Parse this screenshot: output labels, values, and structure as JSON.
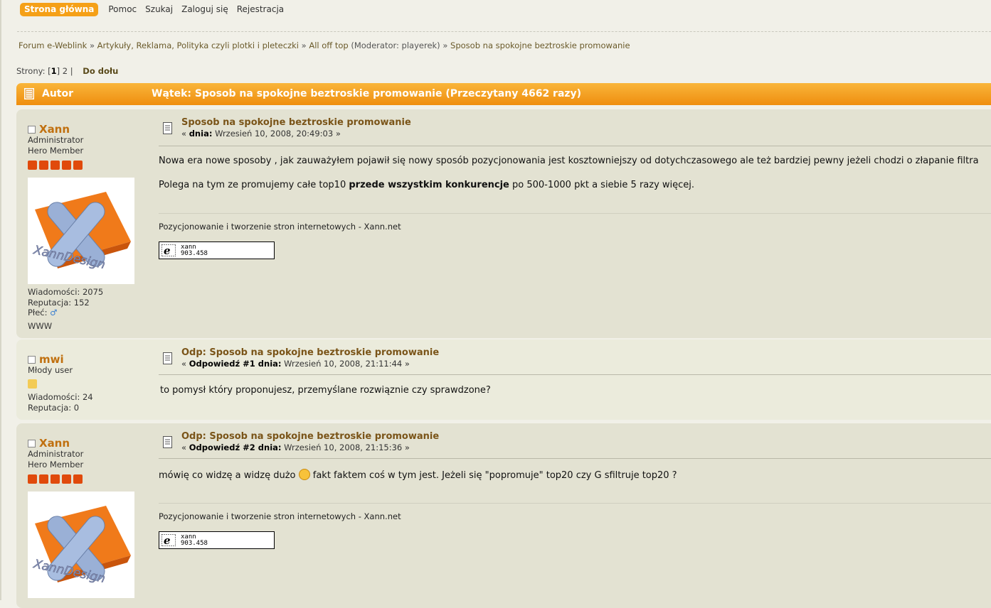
{
  "menu": {
    "home": "Strona główna",
    "help": "Pomoc",
    "search": "Szukaj",
    "login": "Zaloguj się",
    "register": "Rejestracja"
  },
  "breadcrumb": {
    "forum": "Forum e-Weblink",
    "sep1": " » ",
    "board": "Artykuły, Reklama, Polityka czyli plotki i pleteczki",
    "sep2": " » ",
    "subboard": "All off top",
    "moderator": " (Moderator: playerek)",
    "sep3": " » ",
    "topic": "Sposob na spokojne beztroskie promowanie"
  },
  "pagination": {
    "label": "Strony: [",
    "current": "1",
    "close": "]",
    "page2": "2",
    "sep": "|",
    "go_down": "Do dołu"
  },
  "header": {
    "author": "Autor",
    "topic": "Wątek: Sposob na spokojne beztroskie promowanie  (Przeczytany 4662 razy)"
  },
  "posts": [
    {
      "author": "Xann",
      "role": "Administrator",
      "rank": "Hero Member",
      "messages": "Wiadomości: 2075",
      "reputation": "Reputacja: 152",
      "gender_label": "Płeć:",
      "gender_symbol": "♂",
      "www": "WWW",
      "subject": "Sposob na spokojne beztroskie promowanie",
      "meta_open": "« ",
      "meta_bold": "dnia:",
      "meta_date": " Wrzesień 10, 2008, 20:49:03 »",
      "body1": "Nowa era nowe sposoby , jak zauważyłem pojawił się nowy sposób pozycjonowania jest kosztowniejszy od dotychczasowego ale też bardziej pewny jeżeli chodzi o złapanie filtra",
      "body2_pre": "Polega na tym ze promujemy całe top10 ",
      "body2_bold": "przede wszystkim konkurencje",
      "body2_post": " po 500-1000 pkt a siebie 5 razy więcej.",
      "signature": "Pozycjonowanie i tworzenie stron internetowych  - Xann.net",
      "badge_name": "xann",
      "badge_number": "903.458",
      "avatar_text": "XannDesign"
    },
    {
      "author": "mwi",
      "role": "Młody user",
      "messages": "Wiadomości: 24",
      "reputation": "Reputacja: 0",
      "subject": "Odp: Sposob na spokojne beztroskie promowanie",
      "meta_open": "« ",
      "meta_bold": "Odpowiedź #1 dnia:",
      "meta_date": " Wrzesień 10, 2008, 21:11:44 »",
      "body1": "to pomysł który proponujesz, przemyślane rozwiąznie czy sprawdzone?"
    },
    {
      "author": "Xann",
      "role": "Administrator",
      "rank": "Hero Member",
      "subject": "Odp: Sposob na spokojne beztroskie promowanie",
      "meta_open": "« ",
      "meta_bold": "Odpowiedź #2 dnia:",
      "meta_date": " Wrzesień 10, 2008, 21:15:36 »",
      "body1_pre": "mówię co widzę a widzę dużo ",
      "body1_post": " fakt faktem coś w tym jest.  Jeżeli się \"popromuje\" top20 czy G sfiltruje top20 ?",
      "signature": "Pozycjonowanie i tworzenie stron internetowych  - Xann.net",
      "badge_name": "xann",
      "badge_number": "903.458",
      "avatar_text": "XannDesign"
    }
  ],
  "colors": {
    "accent": "#f5a017",
    "author_name": "#c0700f",
    "subject": "#7a5418",
    "post_bg": "#e3e2d2",
    "post_bg_alt": "#ebebdc"
  }
}
